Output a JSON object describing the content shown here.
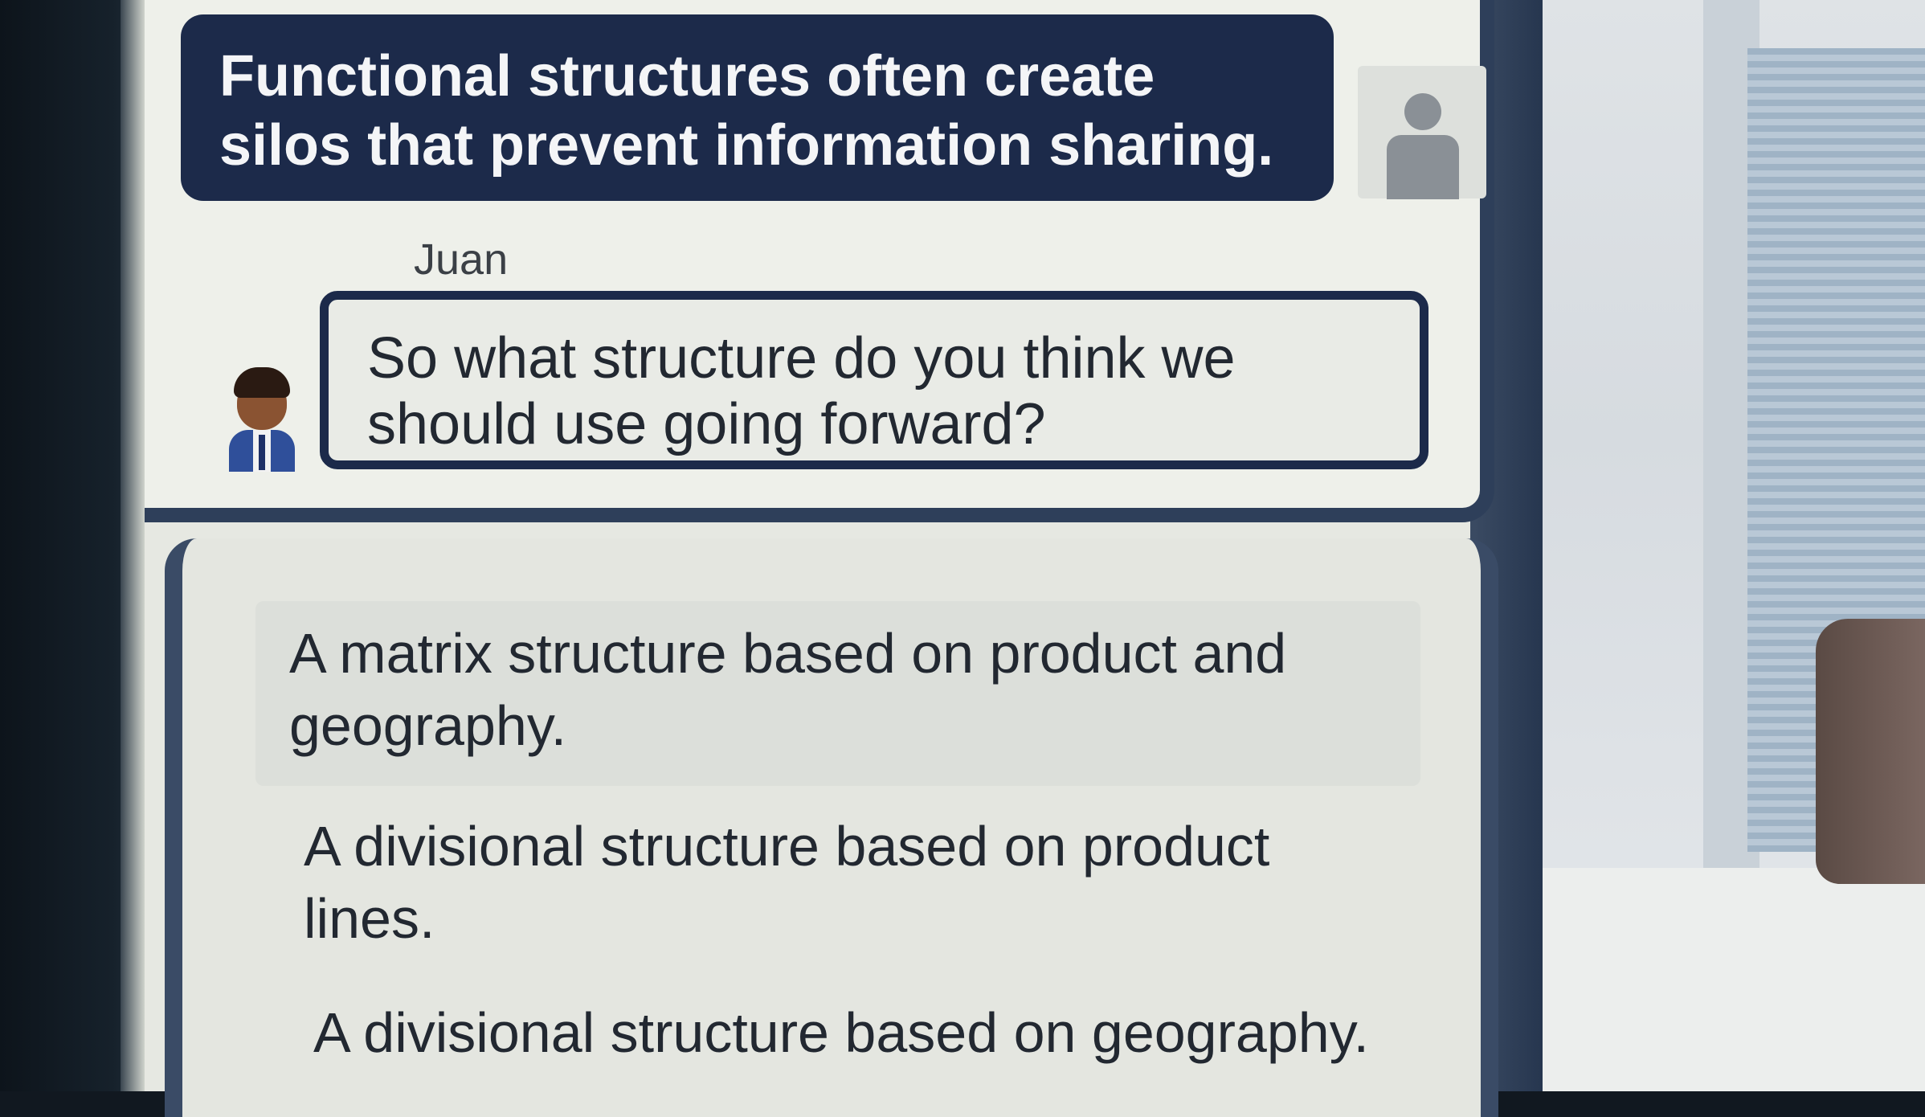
{
  "chat": {
    "previous_message": "Functional structures often create silos that prevent information sharing.",
    "speaker_name": "Juan",
    "current_message": "So what structure do you think we should use going forward?"
  },
  "options": [
    {
      "text": "A matrix structure based on product and geography."
    },
    {
      "text": "A divisional structure based on product lines."
    },
    {
      "text": "A divisional structure based on geography."
    }
  ],
  "colors": {
    "dark_bubble": "#1c2a4a",
    "frame_navy": "#2e3f5a",
    "panel_bg": "#eef0ea"
  }
}
